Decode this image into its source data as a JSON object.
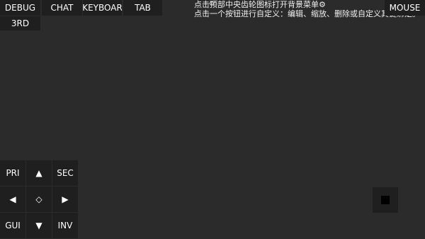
{
  "top_bar": {
    "debug": "DEBUG",
    "chat": "CHAT",
    "keyboard": "KEYBOAR",
    "tab": "TAB",
    "third": "3RD",
    "mouse": "MOUSE"
  },
  "hint": {
    "line1": "点击顶部中央齿轮图标打开背景菜单⚙",
    "line2": "点击一个按钮进行自定义：编辑、缩放、删除或自定义其键绑定。",
    "gear_icon": "⚙"
  },
  "dpad": {
    "pri": "PRI",
    "sec": "SEC",
    "gui": "GUI",
    "inv": "INV",
    "up": "▲",
    "down": "▼",
    "left": "◀",
    "right": "▶",
    "center": "◇"
  },
  "colors": {
    "background": "#2b2b2b",
    "button": "#1f1f1f",
    "text": "#ffffff"
  }
}
